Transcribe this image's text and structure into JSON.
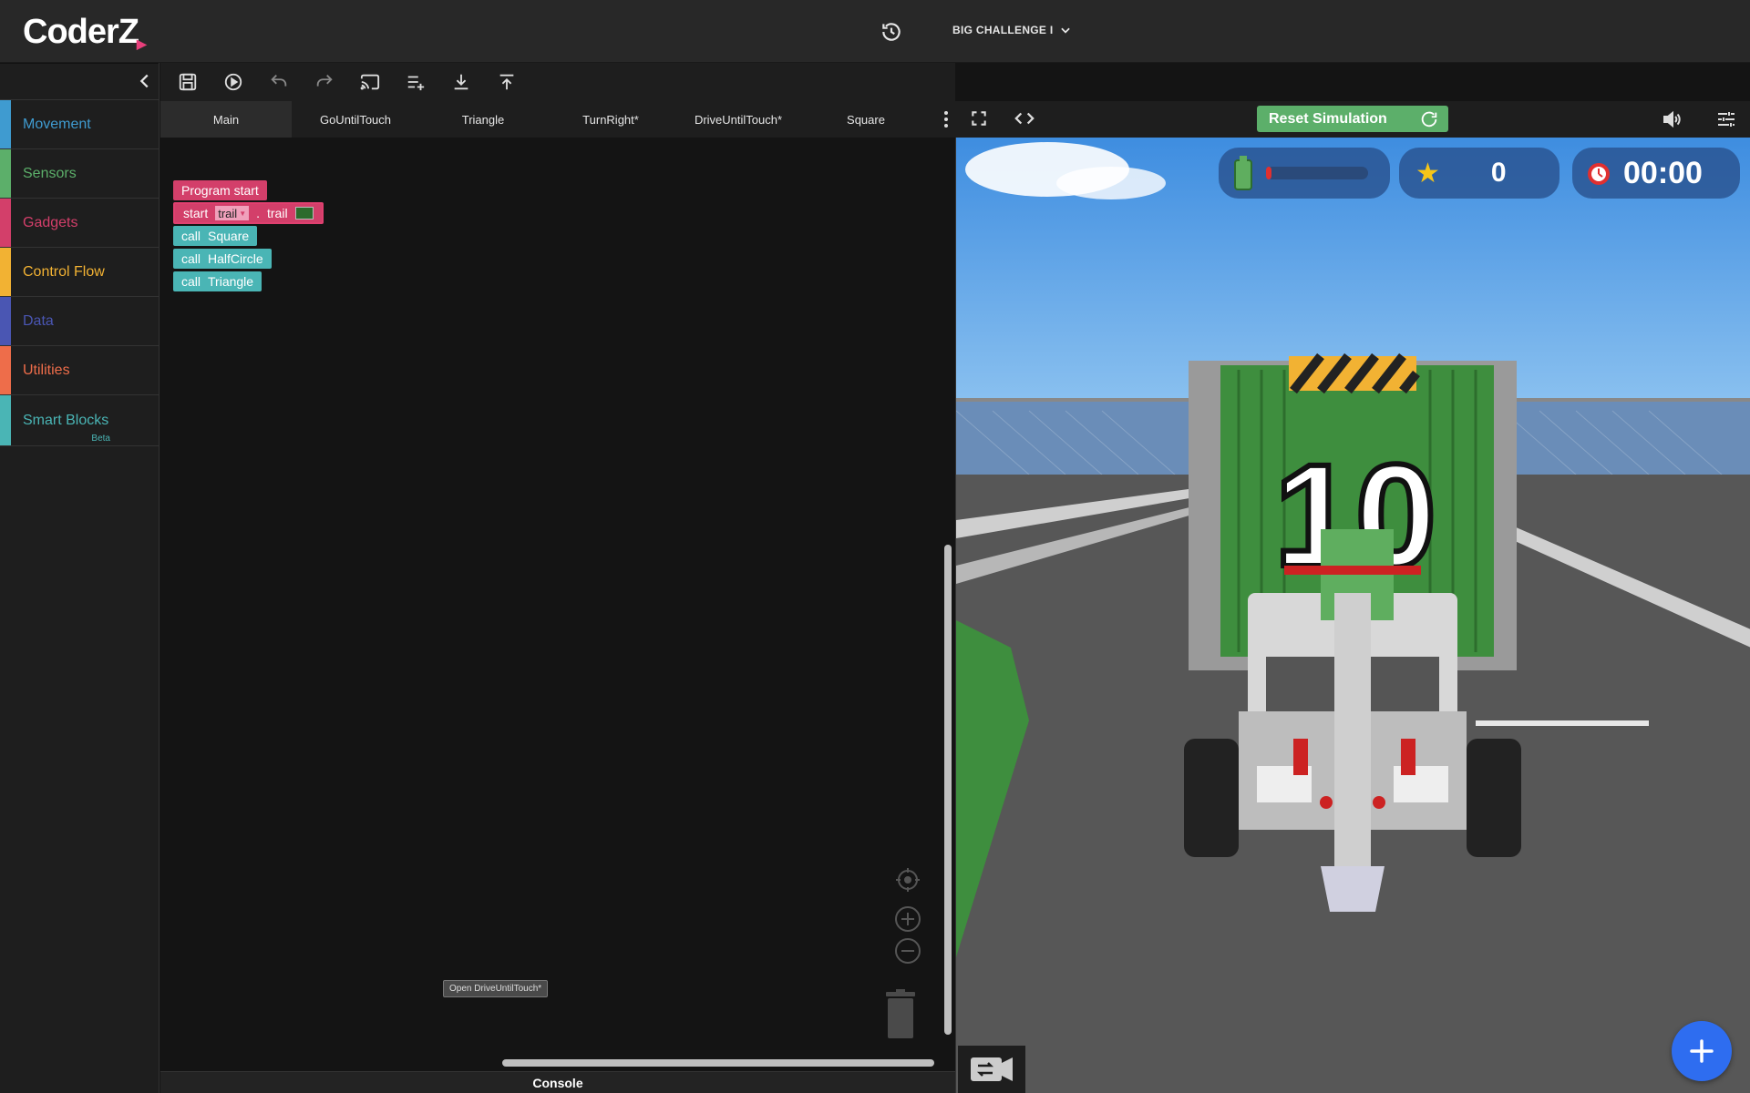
{
  "app": {
    "logo": "CoderZ",
    "challenge": "BIG CHALLENGE I"
  },
  "sidebar": {
    "categories": [
      {
        "label": "Movement",
        "color": "#3f9bd0"
      },
      {
        "label": "Sensors",
        "color": "#5caf6a"
      },
      {
        "label": "Gadgets",
        "color": "#d33f6a"
      },
      {
        "label": "Control Flow",
        "color": "#f2b233"
      },
      {
        "label": "Data",
        "color": "#4a56b3"
      },
      {
        "label": "Utilities",
        "color": "#ee6d4a"
      },
      {
        "label": "Smart Blocks",
        "color": "#4ab5b5",
        "badge": "Beta"
      }
    ]
  },
  "tabs": [
    "Main",
    "GoUntilTouch",
    "Triangle",
    "TurnRight*",
    "DriveUntilTouch*",
    "Square"
  ],
  "blocks": {
    "program_start": "Program start",
    "start_word": "start",
    "trail_dropdown": "trail",
    "dot": ".",
    "trail_word": "trail",
    "call_word": "call",
    "calls": [
      "Square",
      "HalfCircle",
      "Triangle"
    ]
  },
  "tooltip": "Open DriveUntilTouch*",
  "console": "Console",
  "sim": {
    "reset_label": "Reset Simulation",
    "energy_level": 0.05,
    "stars": "0",
    "timer": "00:00",
    "truck_number": "10"
  },
  "icons": [
    "history-icon",
    "chevron-down-icon",
    "collapse-left-icon",
    "save-icon",
    "play-icon",
    "undo-icon",
    "redo-icon",
    "cast-icon",
    "add-list-icon",
    "download-icon",
    "upload-icon",
    "more-vertical-icon",
    "fullscreen-icon",
    "code-icon",
    "refresh-icon",
    "volume-icon",
    "settings-sliders-icon",
    "recenter-icon",
    "zoom-in-icon",
    "zoom-out-icon",
    "trash-icon",
    "camera-switch-icon",
    "plus-icon"
  ]
}
